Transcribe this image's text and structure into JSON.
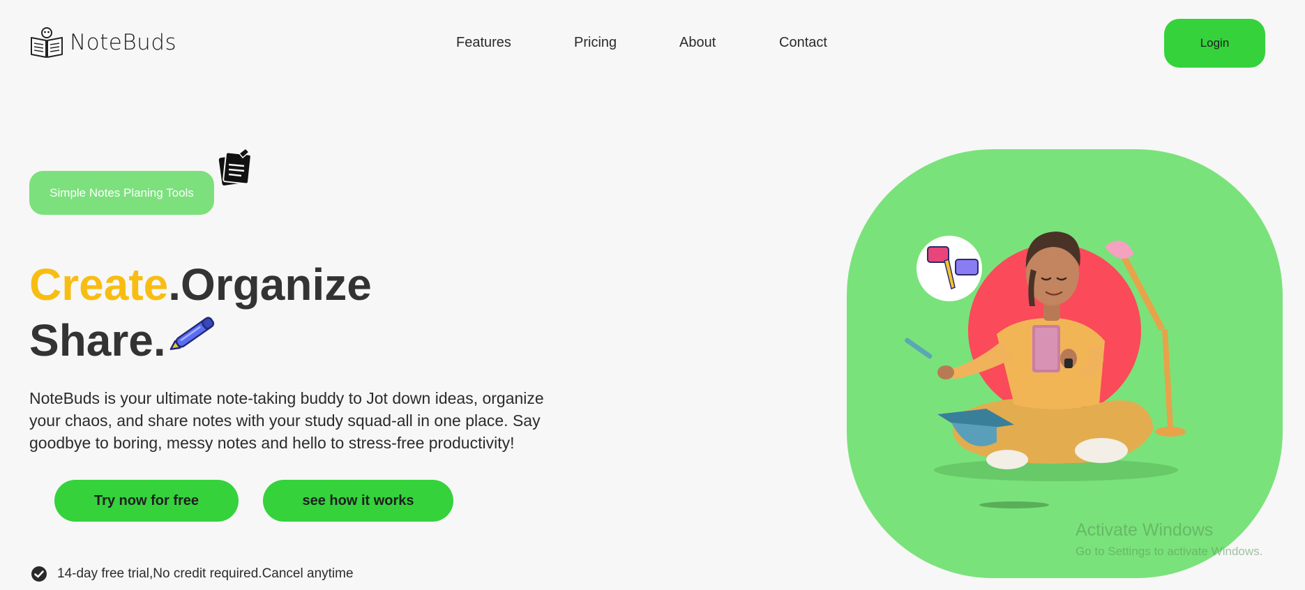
{
  "brand": {
    "name": "NoteBuds",
    "logo_icon": "book-icon"
  },
  "nav": {
    "items": [
      "Features",
      "Pricing",
      "About",
      "Contact"
    ]
  },
  "header": {
    "login_label": "Login"
  },
  "hero": {
    "tag": "Simple Notes Planing Tools",
    "headline": {
      "word1": "Create",
      "dot1": ".",
      "word2": "Organize",
      "word3": "Share."
    },
    "description": "NoteBuds is your ultimate note-taking buddy to Jot down ideas, organize your chaos, and share notes with your study squad-all in one place. Say goodbye to boring, messy notes and hello to stress-free productivity!",
    "cta_primary": "Try now for free",
    "cta_secondary": "see how it works",
    "trial_note": "14-day free trial,No credit required.Cancel anytime"
  },
  "watermark": {
    "title": "Activate Windows",
    "subtitle": "Go to Settings to activate Windows."
  },
  "colors": {
    "accent_green": "#35d23c",
    "pill_green": "#7ce07c",
    "blob_green": "#7ae27a",
    "accent_yellow": "#f8bd12",
    "text_dark": "#333333"
  }
}
